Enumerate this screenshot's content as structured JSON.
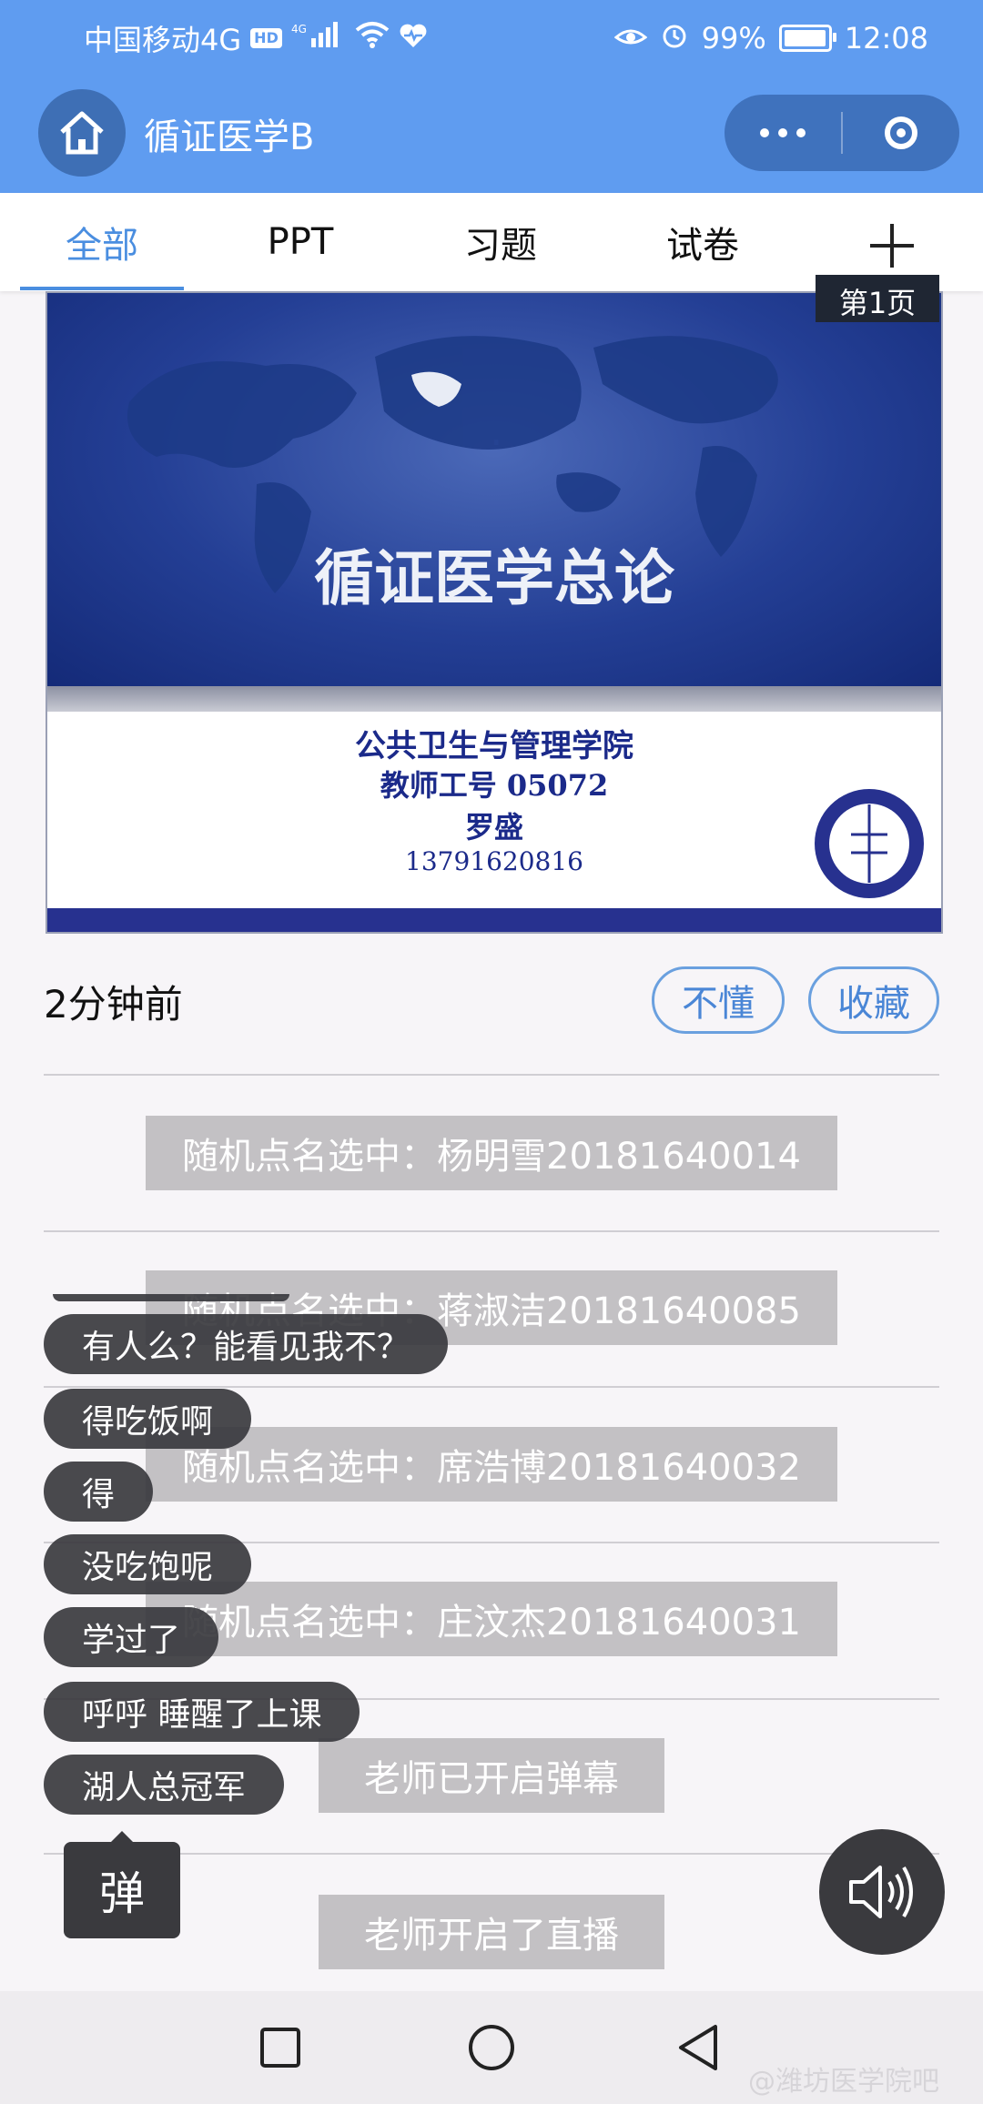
{
  "status_bar": {
    "carrier": "中国移动4G",
    "hd_badge": "HD",
    "signal_label": "⁴ᴳ",
    "battery": "99%",
    "battery_level": 0.99,
    "time": "12:08"
  },
  "header": {
    "title": "循证医学B"
  },
  "tabs": [
    {
      "label": "全部",
      "active": true
    },
    {
      "label": "PPT",
      "active": false
    },
    {
      "label": "习题",
      "active": false
    },
    {
      "label": "试卷",
      "active": false
    }
  ],
  "slide": {
    "page_label": "第1页",
    "title": "循证医学总论",
    "info_lines": [
      "公共卫生与管理学院",
      "教师工号 05072",
      "罗盛",
      "13791620816"
    ]
  },
  "post": {
    "time_ago": "2分钟前",
    "not_understand_label": "不懂",
    "favorite_label": "收藏"
  },
  "notices": [
    "随机点名选中：杨明雪20181640014",
    "随机点名选中：蒋淑洁20181640085",
    "随机点名选中：席浩博20181640032",
    "随机点名选中：庄汶杰20181640031",
    "老师已开启弹幕",
    "老师开启了直播"
  ],
  "danmaku": [
    "有人么？能看见我不？",
    "得吃饭啊",
    "得",
    "没吃饱呢",
    "学过了",
    "呼呼 睡醒了上课",
    "湖人总冠军"
  ],
  "danmaku_button_label": "弹",
  "watermark": "@潍坊医学院吧",
  "colors": {
    "header_blue": "#5f9cf0",
    "accent_blue": "#4a8ee0",
    "notice_gray": "#c3c1c4",
    "danmaku_dark": "#3a3a3e"
  },
  "icons": [
    "home-icon",
    "more-dots-icon",
    "record-target-icon",
    "plus-icon",
    "sound-icon",
    "nav-recent-icon",
    "nav-home-icon",
    "nav-back-icon"
  ]
}
